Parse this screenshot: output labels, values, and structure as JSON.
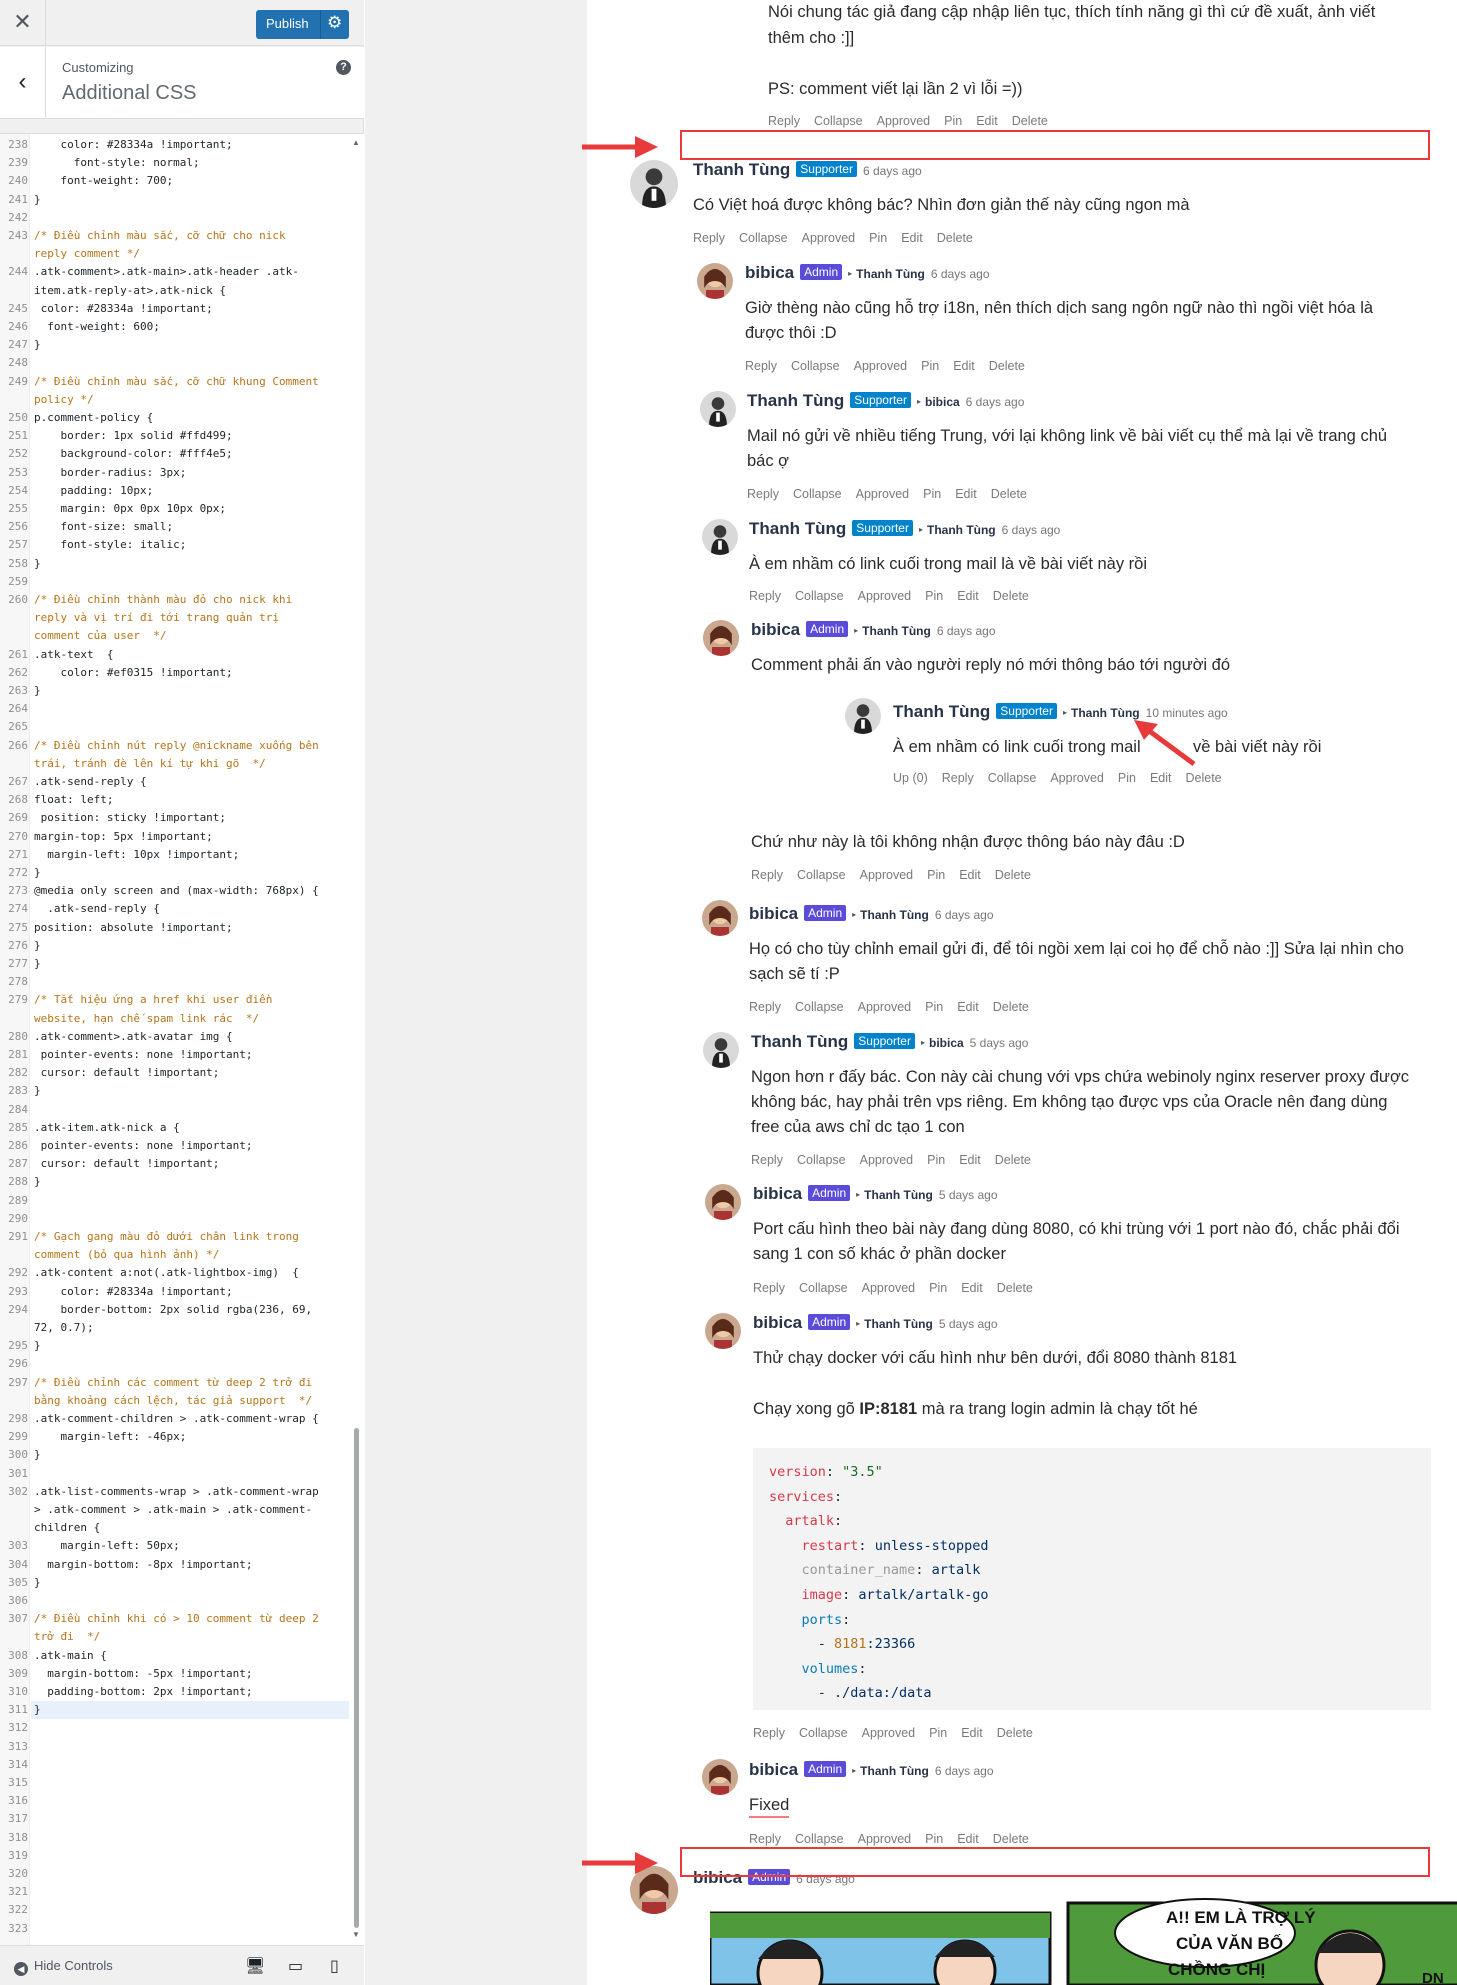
{
  "customizer": {
    "close_label": "✕",
    "publish_label": "Publish",
    "back_label": "‹",
    "customizing_label": "Customizing",
    "section_title": "Additional CSS",
    "help_label": "?",
    "hide_controls_label": "Hide Controls"
  },
  "code_lines": [
    {
      "n": "238",
      "t": "    color: #28334a !important;"
    },
    {
      "n": "239",
      "t": "      font-style: normal;"
    },
    {
      "n": "240",
      "t": "    font-weight: 700;"
    },
    {
      "n": "241",
      "t": "}"
    },
    {
      "n": "242",
      "t": ""
    },
    {
      "n": "243",
      "t": "/* Điều chỉnh màu sắc, cỡ chữ cho nick",
      "c": 1
    },
    {
      "n": "",
      "t": "reply comment */",
      "c": 1
    },
    {
      "n": "244",
      "t": ".atk-comment>.atk-main>.atk-header .atk-"
    },
    {
      "n": "",
      "t": "item.atk-reply-at>.atk-nick {"
    },
    {
      "n": "245",
      "t": " color: #28334a !important;"
    },
    {
      "n": "246",
      "t": "  font-weight: 600;"
    },
    {
      "n": "247",
      "t": "}"
    },
    {
      "n": "248",
      "t": ""
    },
    {
      "n": "249",
      "t": "/* Điều chỉnh màu sắc, cỡ chữ khung Comment",
      "c": 1
    },
    {
      "n": "",
      "t": "policy */",
      "c": 1
    },
    {
      "n": "250",
      "t": "p.comment-policy {"
    },
    {
      "n": "251",
      "t": "    border: 1px solid #ffd499;"
    },
    {
      "n": "252",
      "t": "    background-color: #fff4e5;"
    },
    {
      "n": "253",
      "t": "    border-radius: 3px;"
    },
    {
      "n": "254",
      "t": "    padding: 10px;"
    },
    {
      "n": "255",
      "t": "    margin: 0px 0px 10px 0px;"
    },
    {
      "n": "256",
      "t": "    font-size: small;"
    },
    {
      "n": "257",
      "t": "    font-style: italic;"
    },
    {
      "n": "258",
      "t": "}"
    },
    {
      "n": "259",
      "t": ""
    },
    {
      "n": "260",
      "t": "/* Điều chỉnh thành màu đỏ cho nick khi",
      "c": 1
    },
    {
      "n": "",
      "t": "reply và vị trí đi tới trang quản trị",
      "c": 1
    },
    {
      "n": "",
      "t": "comment của user  */",
      "c": 1
    },
    {
      "n": "261",
      "t": ".atk-text  {"
    },
    {
      "n": "262",
      "t": "    color: #ef0315 !important;"
    },
    {
      "n": "263",
      "t": "}"
    },
    {
      "n": "264",
      "t": ""
    },
    {
      "n": "265",
      "t": ""
    },
    {
      "n": "266",
      "t": "/* Điều chỉnh nút reply @nickname xuống bên",
      "c": 1
    },
    {
      "n": "",
      "t": "trái, tránh đè lên kí tự khi gõ  */",
      "c": 1
    },
    {
      "n": "267",
      "t": ".atk-send-reply {"
    },
    {
      "n": "268",
      "t": "float: left;"
    },
    {
      "n": "269",
      "t": " position: sticky !important;"
    },
    {
      "n": "270",
      "t": "margin-top: 5px !important;"
    },
    {
      "n": "271",
      "t": "  margin-left: 10px !important;"
    },
    {
      "n": "272",
      "t": "}"
    },
    {
      "n": "273",
      "t": "@media only screen and (max-width: 768px) {"
    },
    {
      "n": "274",
      "t": "  .atk-send-reply {"
    },
    {
      "n": "275",
      "t": "position: absolute !important;"
    },
    {
      "n": "276",
      "t": "}"
    },
    {
      "n": "277",
      "t": "}"
    },
    {
      "n": "278",
      "t": ""
    },
    {
      "n": "279",
      "t": "/* Tắt hiệu ứng a href khi user điền",
      "c": 1
    },
    {
      "n": "",
      "t": "website, hạn chế spam link rác  */",
      "c": 1
    },
    {
      "n": "280",
      "t": ".atk-comment>.atk-avatar img {"
    },
    {
      "n": "281",
      "t": " pointer-events: none !important;"
    },
    {
      "n": "282",
      "t": " cursor: default !important;"
    },
    {
      "n": "283",
      "t": "}"
    },
    {
      "n": "284",
      "t": ""
    },
    {
      "n": "285",
      "t": ".atk-item.atk-nick a {"
    },
    {
      "n": "286",
      "t": " pointer-events: none !important;"
    },
    {
      "n": "287",
      "t": " cursor: default !important;"
    },
    {
      "n": "288",
      "t": "}"
    },
    {
      "n": "289",
      "t": ""
    },
    {
      "n": "290",
      "t": ""
    },
    {
      "n": "291",
      "t": "/* Gạch gang màu đỏ dưới chân link trong",
      "c": 1
    },
    {
      "n": "",
      "t": "comment (bỏ qua hình ảnh) */",
      "c": 1
    },
    {
      "n": "292",
      "t": ".atk-content a:not(.atk-lightbox-img)  {"
    },
    {
      "n": "293",
      "t": "    color: #28334a !important;"
    },
    {
      "n": "294",
      "t": "    border-bottom: 2px solid rgba(236, 69,"
    },
    {
      "n": "",
      "t": "72, 0.7);"
    },
    {
      "n": "295",
      "t": "}"
    },
    {
      "n": "296",
      "t": ""
    },
    {
      "n": "297",
      "t": "/* Điều chỉnh các comment từ deep 2 trở đi",
      "c": 1
    },
    {
      "n": "",
      "t": "bằng khoảng cách lệch, tác giả support  */",
      "c": 1
    },
    {
      "n": "298",
      "t": ".atk-comment-children > .atk-comment-wrap {"
    },
    {
      "n": "299",
      "t": "    margin-left: -46px;"
    },
    {
      "n": "300",
      "t": "}"
    },
    {
      "n": "301",
      "t": ""
    },
    {
      "n": "302",
      "t": ".atk-list-comments-wrap > .atk-comment-wrap"
    },
    {
      "n": "",
      "t": "> .atk-comment > .atk-main > .atk-comment-"
    },
    {
      "n": "",
      "t": "children {"
    },
    {
      "n": "303",
      "t": "    margin-left: 50px;"
    },
    {
      "n": "304",
      "t": "  margin-bottom: -8px !important;"
    },
    {
      "n": "305",
      "t": "}"
    },
    {
      "n": "306",
      "t": ""
    },
    {
      "n": "307",
      "t": "/* Điều chỉnh khi có > 10 comment từ deep 2",
      "c": 1
    },
    {
      "n": "",
      "t": "trở đi  */",
      "c": 1
    },
    {
      "n": "308",
      "t": ".atk-main {"
    },
    {
      "n": "309",
      "t": "  margin-bottom: -5px !important;"
    },
    {
      "n": "310",
      "t": "  padding-bottom: 2px !important;"
    },
    {
      "n": "311",
      "t": "}"
    },
    {
      "n": "312",
      "t": ""
    },
    {
      "n": "313",
      "t": ""
    },
    {
      "n": "314",
      "t": ""
    },
    {
      "n": "315",
      "t": ""
    },
    {
      "n": "316",
      "t": ""
    },
    {
      "n": "317",
      "t": ""
    },
    {
      "n": "318",
      "t": ""
    },
    {
      "n": "319",
      "t": ""
    },
    {
      "n": "320",
      "t": ""
    },
    {
      "n": "321",
      "t": ""
    },
    {
      "n": "322",
      "t": ""
    },
    {
      "n": "323",
      "t": ""
    }
  ],
  "actions": {
    "reply": "Reply",
    "collapse": "Collapse",
    "approved": "Approved",
    "pin": "Pin",
    "edit": "Edit",
    "delete": "Delete",
    "up": "Up (0)"
  },
  "top_text": {
    "line1": "Nói chung tác giả đang cập nhập liên tục, thích tính năng gì thì cứ đề xuất, ảnh viết",
    "line2": "thêm cho :]]",
    "line3": "PS: comment viết lại lần 2 vì lỗi =))"
  },
  "comments": [
    {
      "nick": "Thanh Tùng",
      "badge": "Supporter",
      "reply_to": "",
      "time": "6 days ago",
      "text": "Có Việt hoá được không bác? Nhìn đơn giản thế này cũng ngon mà"
    },
    {
      "nick": "bibica",
      "badge": "Admin",
      "reply_to": "Thanh Tùng",
      "time": "6 days ago",
      "text": "Giờ thèng nào cũng hỗ trợ i18n, nên thích dịch sang ngôn ngữ nào thì ngồi việt hóa là",
      "text2": "được thôi :D"
    },
    {
      "nick": "Thanh Tùng",
      "badge": "Supporter",
      "reply_to": "bibica",
      "time": "6 days ago",
      "text": "Mail nó gửi về nhiều tiếng Trung, với lại không link về bài viết cụ thể mà lại về trang chủ",
      "text2": "bác ợ"
    },
    {
      "nick": "Thanh Tùng",
      "badge": "Supporter",
      "reply_to": "Thanh Tùng",
      "time": "6 days ago",
      "text": "À em nhầm có link cuối trong mail là về bài viết này rồi"
    },
    {
      "nick": "bibica",
      "badge": "Admin",
      "reply_to": "Thanh Tùng",
      "time": "6 days ago",
      "text": "Comment phải ấn vào người reply nó mới thông báo tới người đó"
    },
    {
      "nick": "Thanh Tùng",
      "badge": "Supporter",
      "reply_to": "Thanh Tùng",
      "time": "10 minutes ago",
      "text": "À em nhầm có link cuối trong mail",
      "text2": "về bài viết này rồi"
    },
    {
      "text": "Chứ như này là tôi không nhận được thông báo này đâu :D"
    },
    {
      "nick": "bibica",
      "badge": "Admin",
      "reply_to": "Thanh Tùng",
      "time": "6 days ago",
      "text": "Họ có cho tùy chỉnh email gửi đi, để tôi ngồi xem lại coi họ để chỗ nào :]] Sửa lại nhìn cho",
      "text2": "sạch sẽ tí :P"
    },
    {
      "nick": "Thanh Tùng",
      "badge": "Supporter",
      "reply_to": "bibica",
      "time": "5 days ago",
      "text": "Ngon hơn r đấy bác. Con này cài chung với vps chứa webinoly nginx reserver proxy được",
      "text2": "không bác, hay phải trên vps riêng. Em không tạo được vps của Oracle nên đang dùng",
      "text3": "free của aws chỉ dc tạo 1 con"
    },
    {
      "nick": "bibica",
      "badge": "Admin",
      "reply_to": "Thanh Tùng",
      "time": "5 days ago",
      "text": "Port cấu hình theo bài này đang dùng 8080, có khi trùng với 1 port nào đó, chắc phải đổi",
      "text2": "sang 1 con số khác ở phần docker"
    },
    {
      "nick": "bibica",
      "badge": "Admin",
      "reply_to": "Thanh Tùng",
      "time": "5 days ago",
      "text": "Thử chạy docker với cấu hình như bên dưới, đổi 8080 thành 8181",
      "text2a": "Chạy xong gõ ",
      "text2b": "IP:8181",
      "text2c": " mà ra trang login admin là chạy tốt hé"
    },
    {
      "nick": "bibica",
      "badge": "Admin",
      "reply_to": "Thanh Tùng",
      "time": "6 days ago",
      "text": "Fixed"
    },
    {
      "nick": "bibica",
      "badge": "Admin",
      "reply_to": "",
      "time": "6 days ago"
    }
  ],
  "code_block": {
    "l1k": "version",
    "l1v": "\"3.5\"",
    "l2k": "services",
    "l3k": "artalk",
    "l4k": "restart",
    "l4v": "unless-stopped",
    "l5k": "container_name",
    "l5v": "artalk",
    "l6k": "image",
    "l6v": "artalk/artalk-go",
    "l7k": "ports",
    "l8a": "8181",
    "l8b": ":23366",
    "l9k": "volumes",
    "l10v": "./data:/data"
  },
  "comic": {
    "caption1": "A!! EM LÀ TRỢ LÝ",
    "caption2": "CỦA VĂN BỐ",
    "caption3": "CHỒNG CHỊ",
    "caption4": "DN"
  },
  "colors": {
    "admin_badge": "#5b4bd9",
    "supporter_badge": "#0083cb",
    "annotation_red": "#e83a3a",
    "publish_button": "#2271b1"
  }
}
